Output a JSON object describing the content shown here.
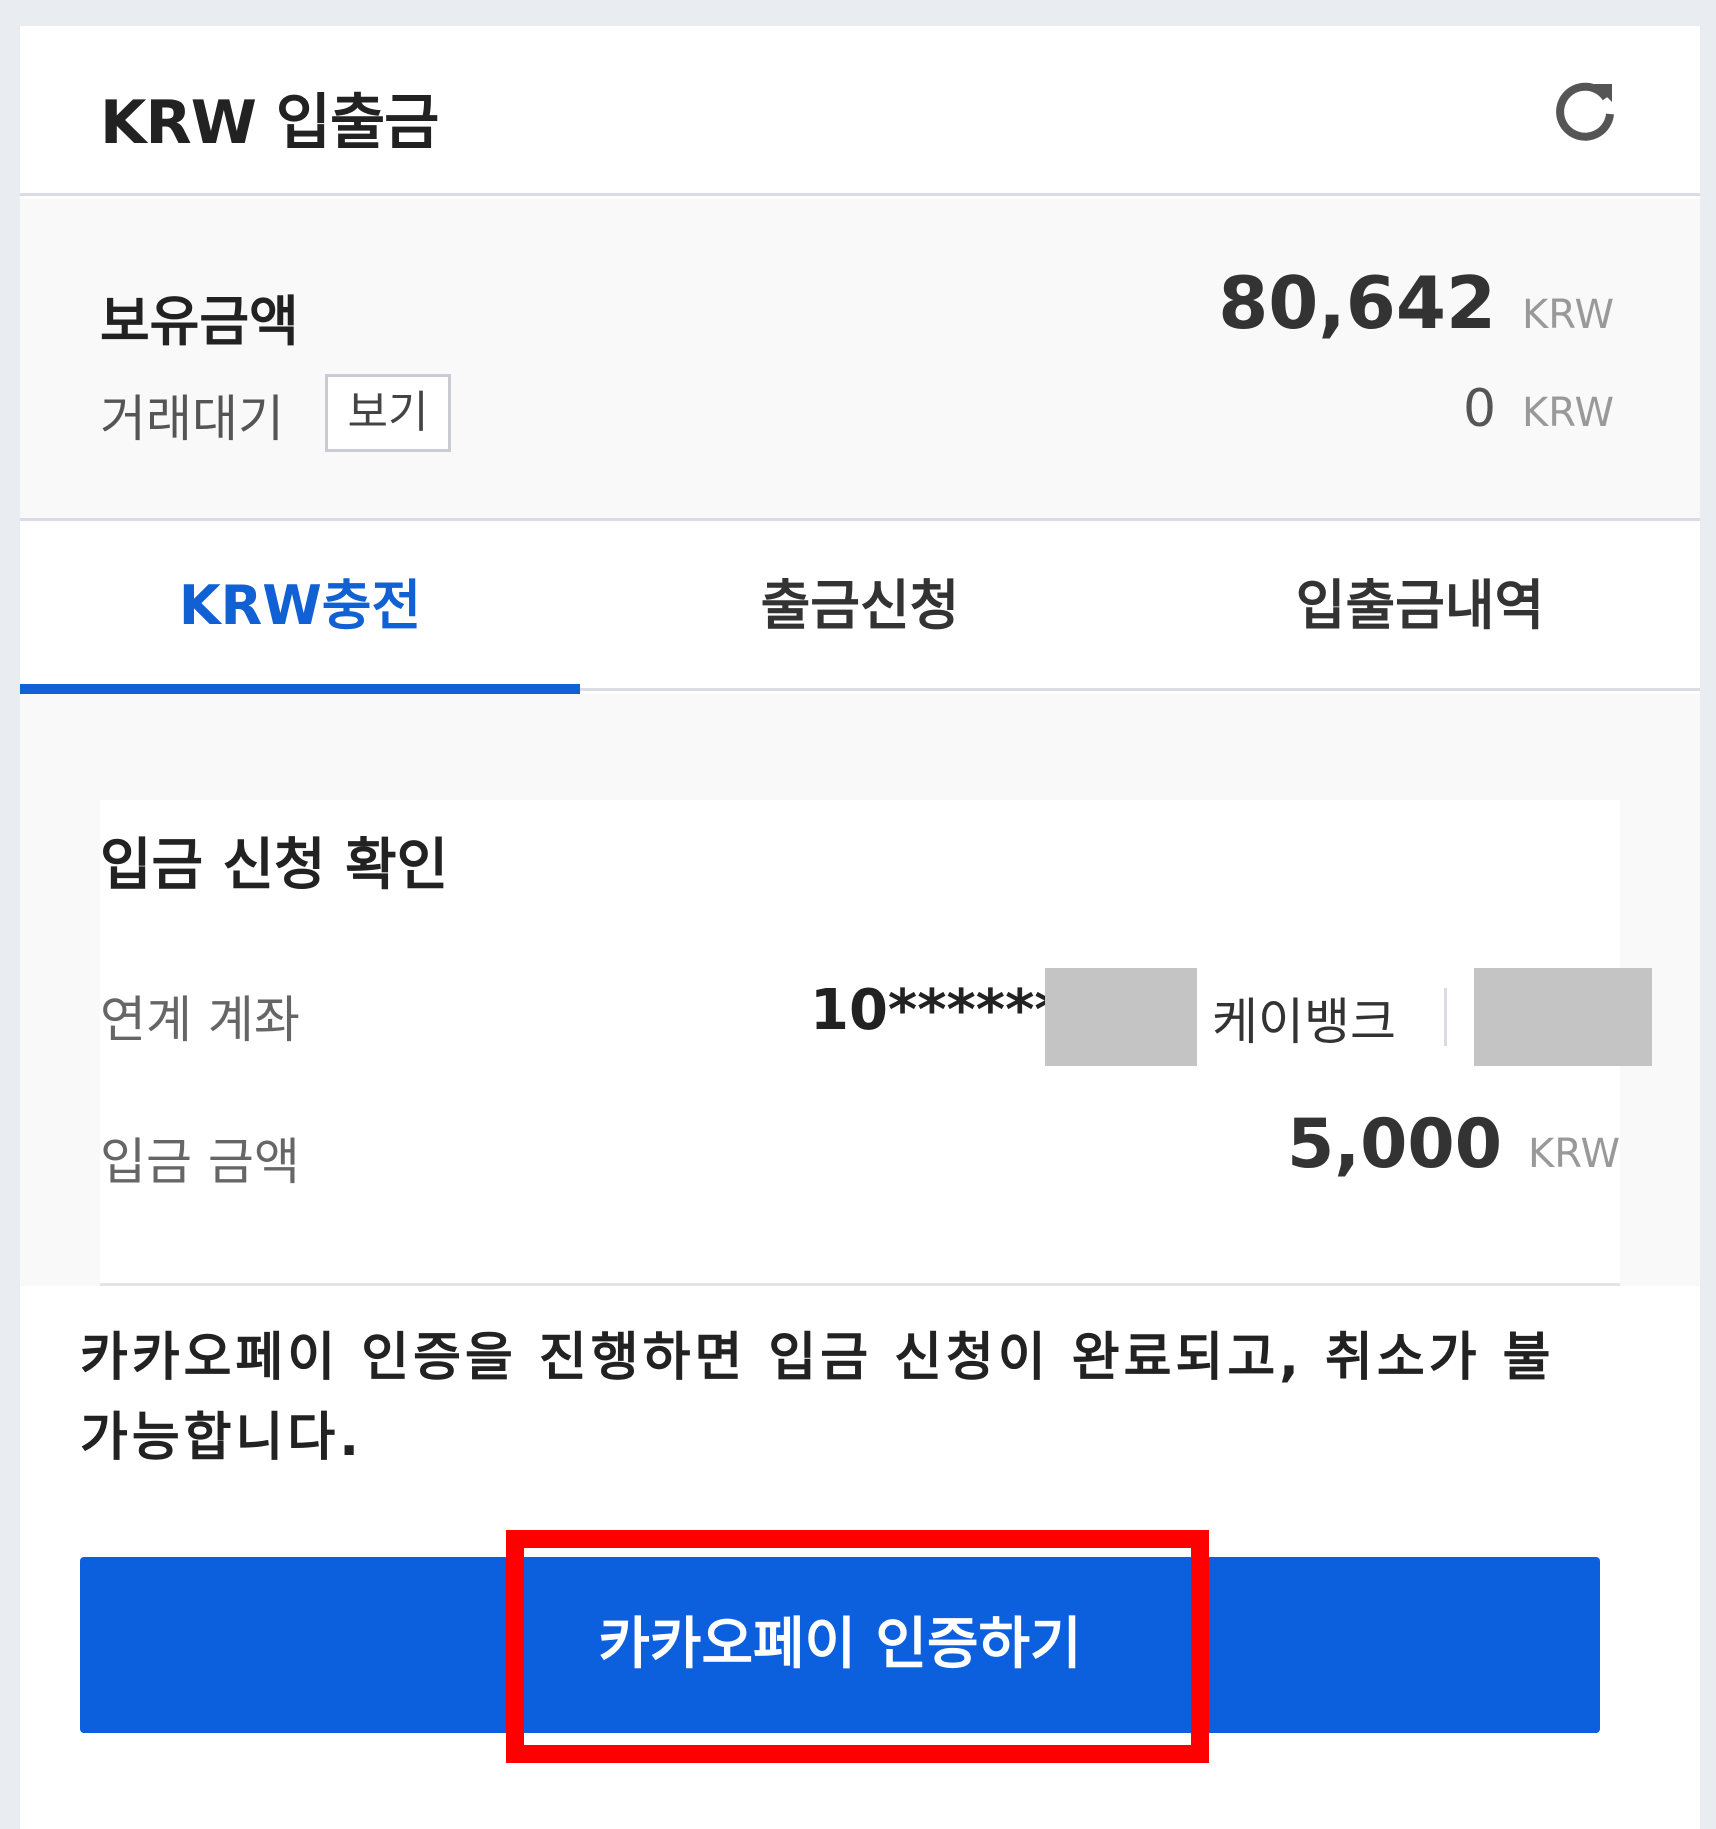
{
  "header": {
    "title": "KRW 입출금",
    "refresh_icon": "refresh-icon"
  },
  "balance": {
    "label": "보유금액",
    "amount": "80,642",
    "unit": "KRW",
    "pending_label": "거래대기",
    "view_button": "보기",
    "pending_amount": "0",
    "pending_unit": "KRW"
  },
  "tabs": [
    {
      "label": "KRW충전",
      "active": true
    },
    {
      "label": "출금신청",
      "active": false
    },
    {
      "label": "입출금내역",
      "active": false
    }
  ],
  "confirm": {
    "title": "입금 신청 확인",
    "account_label": "연계 계좌",
    "account_number": "10*******",
    "bank_name": "케이뱅크",
    "amount_label": "입금 금액",
    "amount": "5,000",
    "amount_unit": "KRW"
  },
  "notice": "카카오페이 인증을 진행하면 입금 신청이 완료되고, 취소가 불가능합니다.",
  "action": {
    "kakao_button": "카카오페이 인증하기"
  },
  "colors": {
    "accent": "#1160d4",
    "button": "#0c5fdd",
    "highlight": "#ff0000",
    "mask": "#c4c4c4"
  }
}
